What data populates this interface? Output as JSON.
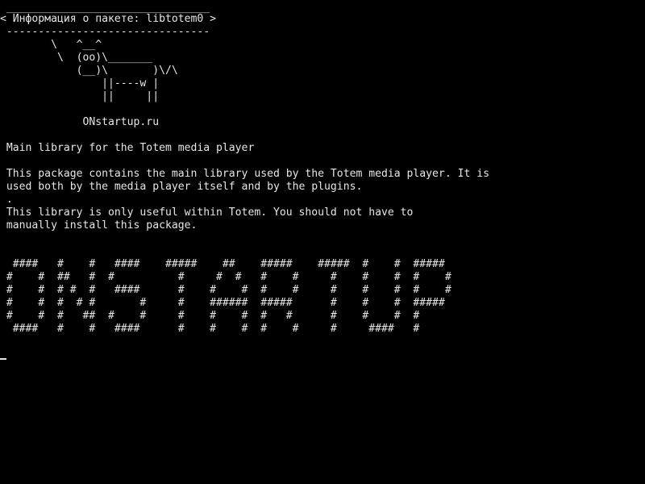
{
  "window": {
    "title": "Информация о пакете: libtotem0"
  },
  "cowsay": {
    "border_top": " ________________________________",
    "title_line": "< Информация о пакете: libtotem0 >",
    "border_bottom": " --------------------------------",
    "cow": [
      "        \\   ^__^",
      "         \\  (oo)\\_______",
      "            (__)\\       )\\/\\",
      "                ||----w |",
      "                ||     ||"
    ],
    "site": "             ONstartup.ru"
  },
  "description": {
    "summary": " Main library for the Totem media player",
    "body": [
      " This package contains the main library used by the Totem media player. It is",
      " used both by the media player itself and by the plugins.",
      " .",
      " This library is only useful within Totem. You should not have to",
      " manually install this package."
    ]
  },
  "banner": [
    "  ####   #    #   ####    #####    ##    #####    #####  #    #  #####",
    " #    #  ##   #  #          #     #  #   #    #     #    #    #  #    #",
    " #    #  # #  #   ####      #    #    #  #    #     #    #    #  #    #",
    " #    #  #  # #       #     #    ######  #####      #    #    #  #####",
    " #    #  #   ##  #    #     #    #    #  #   #      #    #    #  #",
    "  ####   #    #   ####      #    #    #  #    #     #     ####   #"
  ]
}
